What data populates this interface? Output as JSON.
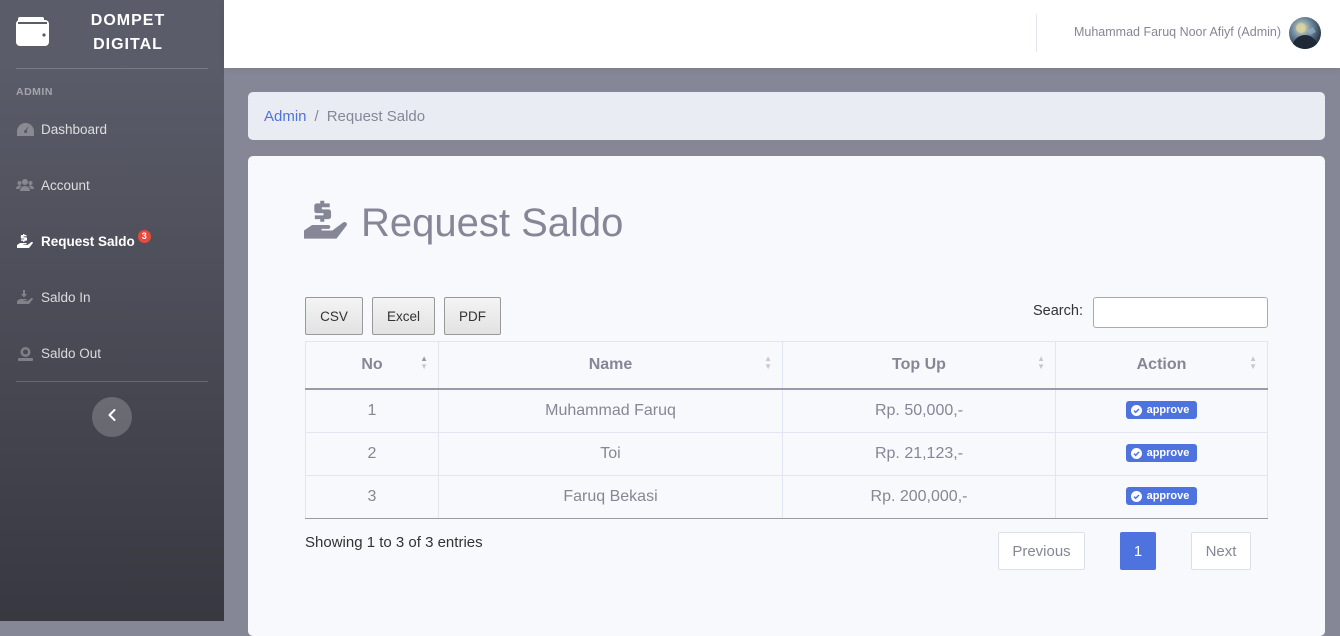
{
  "brand": {
    "line1": "DOMPET",
    "line2": "DIGITAL"
  },
  "sidebar": {
    "heading": "ADMIN",
    "items": [
      {
        "label": "Dashboard",
        "icon": "dashboard-icon"
      },
      {
        "label": "Account",
        "icon": "users-icon"
      },
      {
        "label": "Request Saldo",
        "icon": "hand-dollar-icon",
        "badge": "3",
        "active": true
      },
      {
        "label": "Saldo In",
        "icon": "hand-receive-icon"
      },
      {
        "label": "Saldo Out",
        "icon": "coins-icon"
      }
    ]
  },
  "topbar": {
    "user_name": "Muhammad Faruq Noor Afiyf (Admin)"
  },
  "breadcrumb": {
    "parent": "Admin",
    "separator": "/",
    "current": "Request Saldo"
  },
  "page": {
    "title": "Request Saldo"
  },
  "export_buttons": {
    "csv": "CSV",
    "excel": "Excel",
    "pdf": "PDF"
  },
  "search": {
    "label": "Search:",
    "value": ""
  },
  "table": {
    "headers": [
      "No",
      "Name",
      "Top Up",
      "Action"
    ],
    "rows": [
      {
        "no": "1",
        "name": "Muhammad Faruq",
        "top_up": "Rp. 50,000,-",
        "action": "approve"
      },
      {
        "no": "2",
        "name": "Toi",
        "top_up": "Rp. 21,123,-",
        "action": "approve"
      },
      {
        "no": "3",
        "name": "Faruq Bekasi",
        "top_up": "Rp. 200,000,-",
        "action": "approve"
      }
    ]
  },
  "footer": {
    "info": "Showing 1 to 3 of 3 entries",
    "previous": "Previous",
    "page": "1",
    "next": "Next"
  },
  "colors": {
    "primary": "#4e73df",
    "danger": "#e74a3b",
    "sidebar": "#5a5c69",
    "text_muted": "#858796"
  }
}
